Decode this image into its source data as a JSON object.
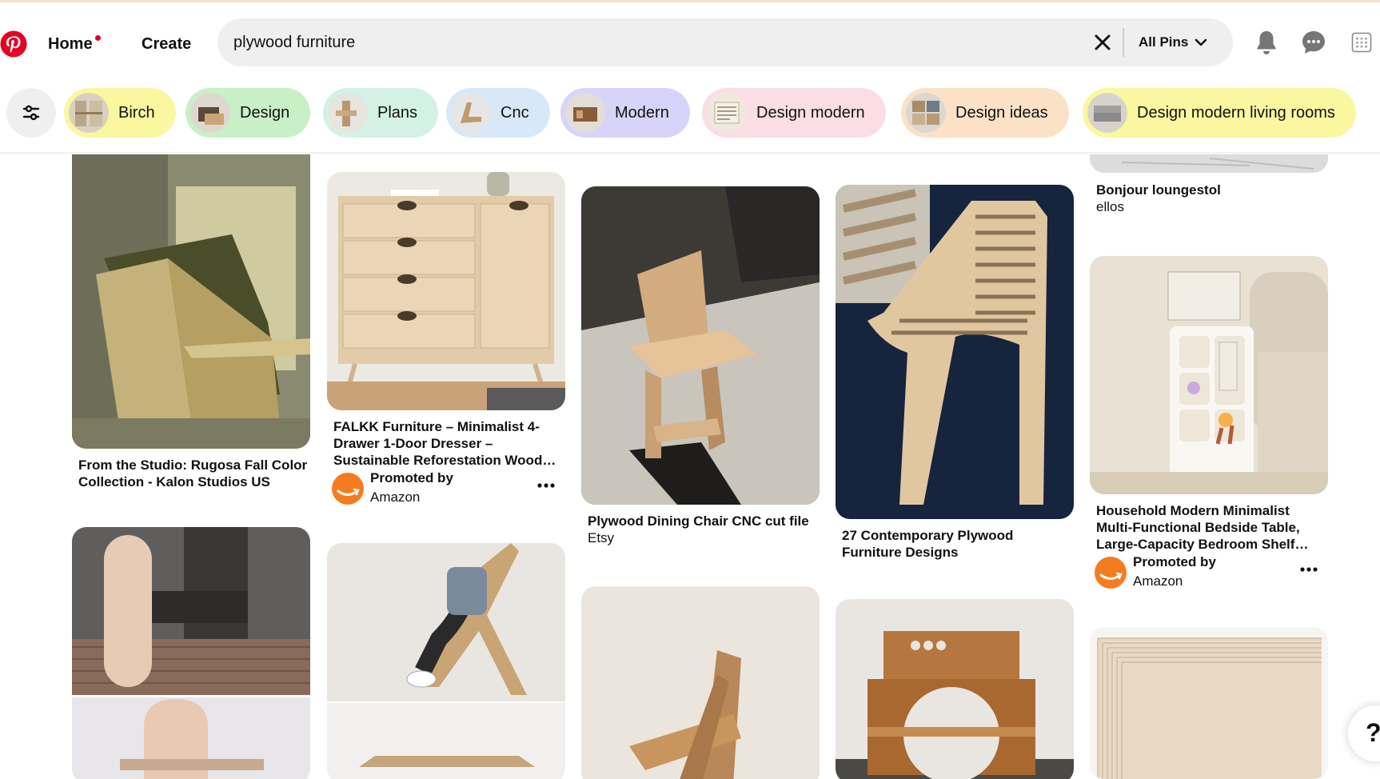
{
  "header": {
    "nav": {
      "home": "Home",
      "create": "Create"
    },
    "search": {
      "query": "plywood furniture",
      "filter_label": "All Pins"
    }
  },
  "chips": [
    {
      "label": "Birch",
      "color": "#fbf7a1"
    },
    {
      "label": "Design",
      "color": "#c9efc6"
    },
    {
      "label": "Plans",
      "color": "#d3f2e5"
    },
    {
      "label": "Cnc",
      "color": "#d8e8f8"
    },
    {
      "label": "Modern",
      "color": "#d8d4f9"
    },
    {
      "label": "Design modern",
      "color": "#fbdee5"
    },
    {
      "label": "Design ideas",
      "color": "#fbe2c6"
    },
    {
      "label": "Design modern living rooms",
      "color": "#fbf7a1"
    }
  ],
  "pins": {
    "p1": {
      "title": "From the Studio: Rugosa Fall Color Collection - Kalon Studios US"
    },
    "p2": {
      "title": "FALKK Furniture – Minimalist 4-Drawer 1-Door Dresser – Sustainable Reforestation Wood…",
      "promo_by": "Promoted by",
      "promo_name": "Amazon"
    },
    "p3": {
      "title": "Plywood Dining Chair CNC cut file",
      "sub": "Etsy"
    },
    "p4": {
      "title": "27 Contemporary Plywood Furniture Designs"
    },
    "p5": {
      "title": "Bonjour loungestol",
      "sub": "ellos"
    },
    "p6": {
      "title": "Household Modern Minimalist Multi-Functional Bedside Table, Large-Capacity Bedroom Shelf…",
      "promo_by": "Promoted by",
      "promo_name": "Amazon"
    }
  },
  "help": {
    "label": "?"
  },
  "colors": {
    "brand": "#e60023",
    "promo_avatar": "#f47c20"
  }
}
